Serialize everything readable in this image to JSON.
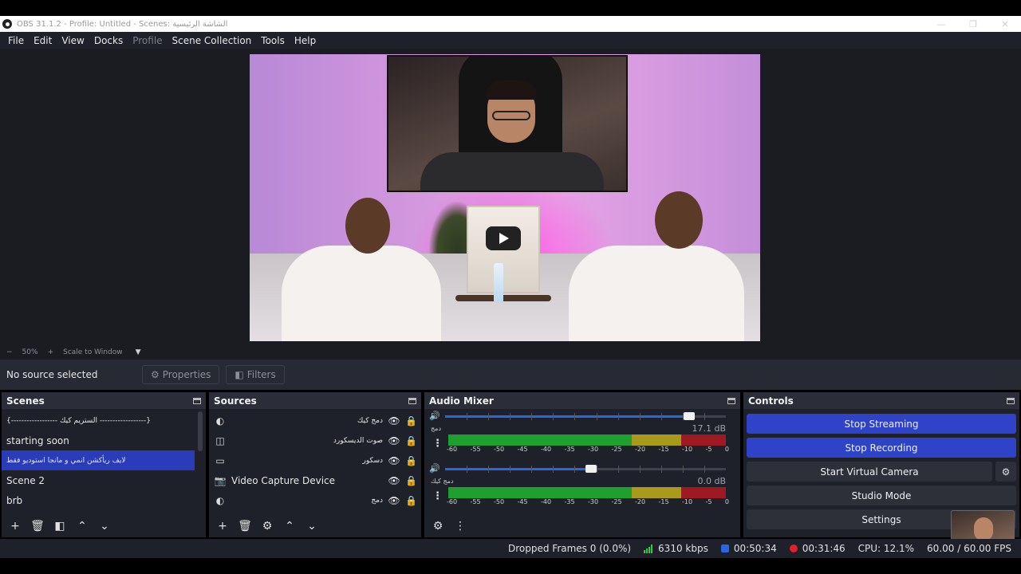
{
  "window": {
    "title": "OBS 31.1.2 - Profile: Untitled - Scenes: الشاشة الرئيسية",
    "controls": [
      "—",
      "❐",
      "✕"
    ]
  },
  "menu": [
    "File",
    "Edit",
    "View",
    "Docks",
    "Profile",
    "Scene Collection",
    "Tools",
    "Help"
  ],
  "preview": {
    "zoom_minus": "−",
    "zoom_value": "50%",
    "zoom_plus": "+",
    "scale_mode": "Scale to Window"
  },
  "source_toolbar": {
    "status": "No source selected",
    "properties": "Properties",
    "filters": "Filters"
  },
  "scenes": {
    "title": "Scenes",
    "items": [
      {
        "label": "{------------------ الستريم كيك ------------------}"
      },
      {
        "label": "starting soon"
      },
      {
        "label": "لايف ريأكشن انمي و مانجا  استوديو فقط"
      },
      {
        "label": "Scene 2"
      },
      {
        "label": "brb"
      }
    ],
    "selected_index": 2
  },
  "sources": {
    "title": "Sources",
    "items": [
      {
        "label": "دمج كيك",
        "icon": "browser-icon"
      },
      {
        "label": "صوت الديسكورد",
        "icon": "audio-output-icon"
      },
      {
        "label": "دسكور",
        "icon": "display-capture-icon"
      },
      {
        "label": "Video Capture Device",
        "icon": "camera-icon"
      },
      {
        "label": "دمج",
        "icon": "browser-icon"
      }
    ]
  },
  "mixer": {
    "title": "Audio Mixer",
    "channels": [
      {
        "name": "دمج",
        "db": "17.1 dB",
        "volume": 0.87
      },
      {
        "name": "دمج كيك",
        "db": "0.0 dB",
        "volume": 0.52
      }
    ],
    "scale": [
      "-60",
      "-55",
      "-50",
      "-45",
      "-40",
      "-35",
      "-30",
      "-25",
      "-20",
      "-15",
      "-10",
      "-5",
      "0"
    ]
  },
  "controls": {
    "title": "Controls",
    "stop_streaming": "Stop Streaming",
    "stop_recording": "Stop Recording",
    "start_virtual_camera": "Start Virtual Camera",
    "studio_mode": "Studio Mode",
    "settings": "Settings"
  },
  "status": {
    "dropped_frames": "Dropped Frames 0 (0.0%)",
    "bitrate": "6310 kbps",
    "stream_time": "00:50:34",
    "record_time": "00:31:46",
    "cpu": "CPU: 12.1%",
    "fps": "60.00 / 60.00 FPS"
  },
  "colors": {
    "accent": "#2f43c9",
    "dock_bg": "#1f212a",
    "meter_green": "#1f9f2e",
    "meter_yellow": "#a89a1a",
    "meter_red": "#9e1a22",
    "record_dot": "#e0202a",
    "stream_dot": "#2a66e0"
  }
}
